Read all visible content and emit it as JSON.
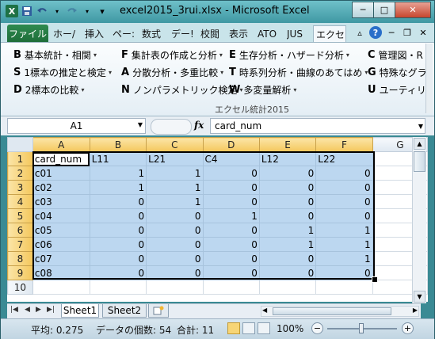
{
  "window": {
    "title": "excel2015_3rui.xlsx - Microsoft Excel",
    "minimize": "─",
    "maximize": "□",
    "close": "✕"
  },
  "qat": {
    "app_icon": "X",
    "save_icon": "save-icon",
    "undo_icon": "undo-icon",
    "redo_icon": "redo-icon",
    "customize": "▾"
  },
  "tabs": {
    "file": "ファイル",
    "items": [
      "ホー/",
      "挿入",
      "ペー:",
      "数式",
      "デー!",
      "校閲",
      "表示",
      "ATO",
      "JUS",
      "エクセ"
    ],
    "active": "エクセ"
  },
  "ribbon": {
    "buttons": [
      {
        "key": "B",
        "label": "基本統計・相関"
      },
      {
        "key": "S",
        "label": "1標本の推定と検定"
      },
      {
        "key": "D",
        "label": "2標本の比較"
      },
      {
        "key": "F",
        "label": "集計表の作成と分析"
      },
      {
        "key": "A",
        "label": "分散分析・多重比較"
      },
      {
        "key": "N",
        "label": "ノンパラメトリック検定"
      },
      {
        "key": "E",
        "label": "生存分析・ハザード分析"
      },
      {
        "key": "T",
        "label": "時系列分析・曲線のあてはめ"
      },
      {
        "key": "W",
        "label": "多変量解析"
      },
      {
        "key": "C",
        "label": "管理図・R"
      },
      {
        "key": "G",
        "label": "特殊なグラ"
      },
      {
        "key": "U",
        "label": "ユーティリ"
      }
    ],
    "group_label": "エクセル統計2015"
  },
  "formula_bar": {
    "name_box": "A1",
    "fx": "fx",
    "formula": "card_num"
  },
  "grid": {
    "columns": [
      "A",
      "B",
      "C",
      "D",
      "E",
      "F",
      "G"
    ],
    "rows": [
      [
        "card_num",
        "L11",
        "L21",
        "C4",
        "L12",
        "L22",
        ""
      ],
      [
        "c01",
        "1",
        "1",
        "0",
        "0",
        "0",
        ""
      ],
      [
        "c02",
        "1",
        "1",
        "0",
        "0",
        "0",
        ""
      ],
      [
        "c03",
        "0",
        "1",
        "0",
        "0",
        "0",
        ""
      ],
      [
        "c04",
        "0",
        "0",
        "1",
        "0",
        "0",
        ""
      ],
      [
        "c05",
        "0",
        "0",
        "0",
        "1",
        "1",
        ""
      ],
      [
        "c06",
        "0",
        "0",
        "0",
        "1",
        "1",
        ""
      ],
      [
        "c07",
        "0",
        "0",
        "0",
        "0",
        "1",
        ""
      ],
      [
        "c08",
        "0",
        "0",
        "0",
        "0",
        "0",
        ""
      ],
      [
        "",
        "",
        "",
        "",
        "",
        "",
        ""
      ]
    ],
    "row_numbers": [
      "1",
      "2",
      "3",
      "4",
      "5",
      "6",
      "7",
      "8",
      "9",
      "10"
    ]
  },
  "sheets": {
    "tabs": [
      "Sheet1",
      "Sheet2"
    ],
    "active": "Sheet1"
  },
  "status": {
    "average": "平均: 0.275",
    "count": "データの個数: 54",
    "sum": "合計: 11",
    "zoom": "100%"
  }
}
